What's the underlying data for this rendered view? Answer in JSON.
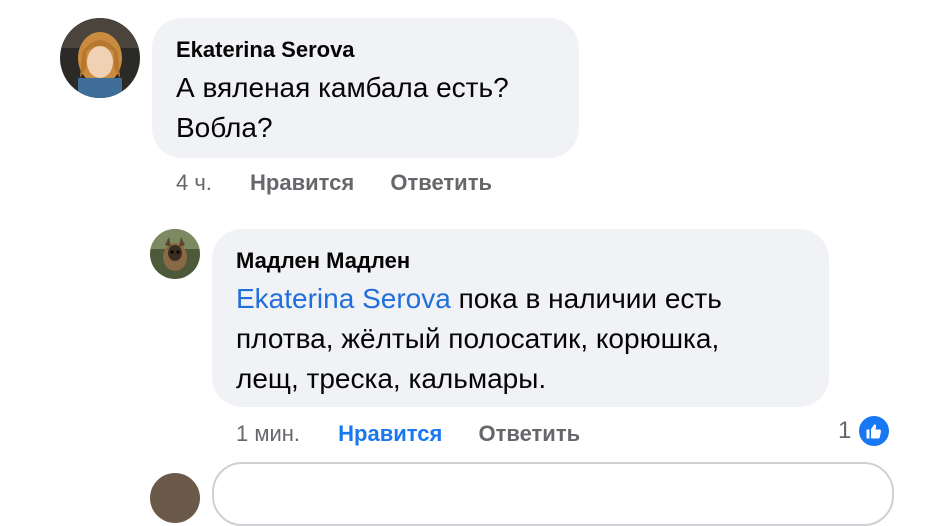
{
  "comment": {
    "author": "Ekaterina Serova",
    "text_line1": "А вяленая камбала есть?",
    "text_line2": "Вобла?",
    "time": "4 ч.",
    "like_label": "Нравится",
    "reply_label": "Ответить"
  },
  "reply": {
    "author": "Мадлен Мадлен",
    "mention": "Ekaterina Serova",
    "text_line1_rest": " пока в наличии есть",
    "text_line2": "плотва, жёлтый полосатик, корюшка,",
    "text_line3": "лещ, треска, кальмары.",
    "time": "1 мин.",
    "like_label": "Нравится",
    "reply_label": "Ответить",
    "reaction_count": "1",
    "reaction_icon": "thumbs-up-icon",
    "liked_color": "#1877f2"
  },
  "colors": {
    "bubble": "#f0f2f5",
    "meta": "#65676b",
    "mention": "#216fdb",
    "accent": "#1877f2"
  }
}
